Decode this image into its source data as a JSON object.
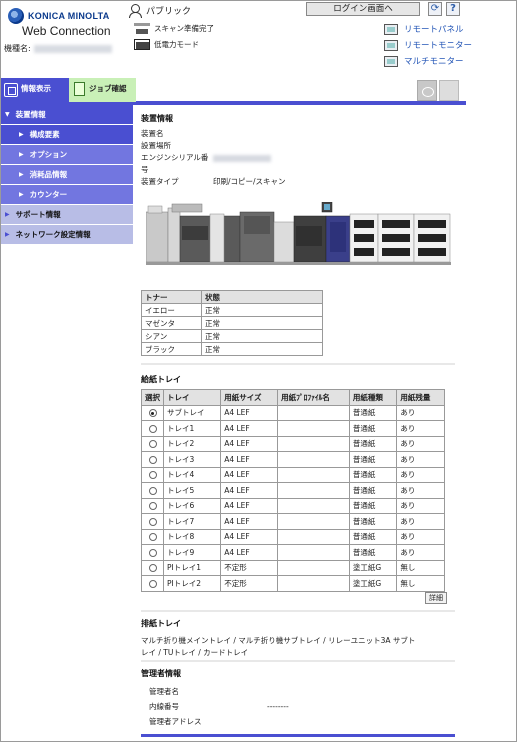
{
  "brand": {
    "logo_text": "KONICA MINOLTA",
    "product": "Web Connection",
    "device_label": "機種名:"
  },
  "header": {
    "user": "パブリック",
    "login_button": "ログイン画面へ",
    "refresh_glyph": "⟳",
    "help_glyph": "?",
    "status": [
      "スキャン準備完了",
      "低電力モード"
    ],
    "links": [
      "リモートパネル",
      "リモートモニター",
      "マルチモニター"
    ]
  },
  "tabs": {
    "info": "情報表示",
    "job": "ジョブ確認"
  },
  "sidebar": {
    "header": "装置情報",
    "items": [
      "構成要素",
      "オプション",
      "消耗品情報",
      "カウンター"
    ],
    "top_items": [
      "サポート情報",
      "ネットワーク設定情報"
    ]
  },
  "device_info": {
    "title": "装置情報",
    "rows": [
      {
        "key": "装置名",
        "value": ""
      },
      {
        "key": "設置場所",
        "value": ""
      },
      {
        "key": "エンジンシリアル番号",
        "value": ""
      },
      {
        "key": "装置タイプ",
        "value": "印刷/コピー/スキャン"
      }
    ]
  },
  "toner": {
    "headers": [
      "トナー",
      "状態"
    ],
    "rows": [
      [
        "イエロー",
        "正常"
      ],
      [
        "マゼンタ",
        "正常"
      ],
      [
        "シアン",
        "正常"
      ],
      [
        "ブラック",
        "正常"
      ]
    ]
  },
  "paper_trays": {
    "title": "給紙トレイ",
    "headers": [
      "選択",
      "トレイ",
      "用紙サイズ",
      "用紙ﾌﾟﾛﾌｧｲﾙ名",
      "用紙種類",
      "用紙残量"
    ],
    "rows": [
      [
        "on",
        "サブトレイ",
        "A4 LEF",
        "",
        "普通紙",
        "あり"
      ],
      [
        "off",
        "トレイ1",
        "A4 LEF",
        "",
        "普通紙",
        "あり"
      ],
      [
        "off",
        "トレイ2",
        "A4 LEF",
        "",
        "普通紙",
        "あり"
      ],
      [
        "off",
        "トレイ3",
        "A4 LEF",
        "",
        "普通紙",
        "あり"
      ],
      [
        "off",
        "トレイ4",
        "A4 LEF",
        "",
        "普通紙",
        "あり"
      ],
      [
        "off",
        "トレイ5",
        "A4 LEF",
        "",
        "普通紙",
        "あり"
      ],
      [
        "off",
        "トレイ6",
        "A4 LEF",
        "",
        "普通紙",
        "あり"
      ],
      [
        "off",
        "トレイ7",
        "A4 LEF",
        "",
        "普通紙",
        "あり"
      ],
      [
        "off",
        "トレイ8",
        "A4 LEF",
        "",
        "普通紙",
        "あり"
      ],
      [
        "off",
        "トレイ9",
        "A4 LEF",
        "",
        "普通紙",
        "あり"
      ],
      [
        "off",
        "PIトレイ1",
        "不定形",
        "",
        "塗工紙G",
        "無し"
      ],
      [
        "off",
        "PIトレイ2",
        "不定形",
        "",
        "塗工紙G",
        "無し"
      ]
    ],
    "detail_button": "詳細"
  },
  "output_trays": {
    "title": "排紙トレイ",
    "text_line1": "マルチ折り機メイントレイ / マルチ折り機サブトレイ / リレーユニット3A サブト",
    "text_line2": "レイ / TUトレイ / カードトレイ"
  },
  "admin": {
    "title": "管理者情報",
    "rows": [
      {
        "key": "管理者名",
        "value": ""
      },
      {
        "key": "内線番号",
        "value": "--------"
      },
      {
        "key": "管理者アドレス",
        "value": ""
      }
    ]
  },
  "colors": {
    "accent": "#4a4fd1",
    "sidebar_sub": "#7276e0",
    "sidebar_top": "#b8bde6",
    "job_tab": "#c9f0b7",
    "link": "#2355b6"
  }
}
